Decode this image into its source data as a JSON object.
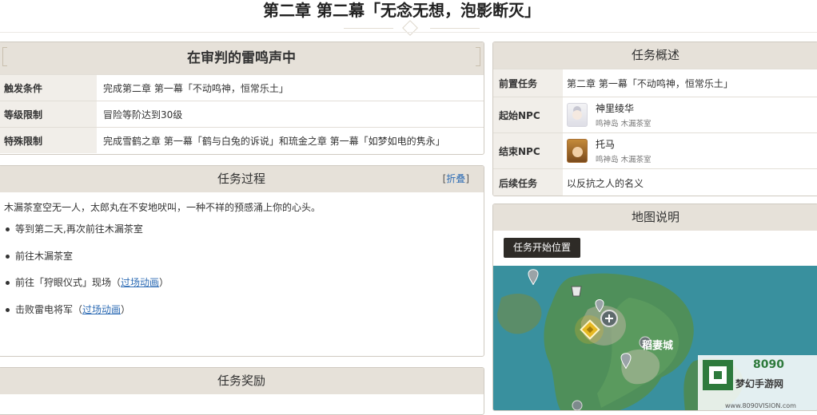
{
  "page": {
    "title": "第二章 第二幕「无念无想，泡影断灭」"
  },
  "trigger": {
    "heading": "在审判的雷鸣声中",
    "rows": [
      {
        "key": "触发条件",
        "value": "完成第二章 第一幕「不动鸣神，恒常乐土」"
      },
      {
        "key": "等级限制",
        "value": "冒险等阶达到30级"
      },
      {
        "key": "特殊限制",
        "value": "完成雪鹤之章 第一幕「鹤与白兔的诉说」和琉金之章 第一幕「如梦如电的隽永」"
      }
    ]
  },
  "process": {
    "heading": "任务过程",
    "collapse_open": "[",
    "collapse_label": "折叠",
    "collapse_close": "]",
    "intro": "木漏茶室空无一人，太郎丸在不安地吠叫，一种不祥的预感涌上你的心头。",
    "steps": [
      {
        "text": "等到第二天,再次前往木漏茶室",
        "link": "",
        "suffix_open": "",
        "suffix_close": ""
      },
      {
        "text": "前往木漏茶室",
        "link": "",
        "suffix_open": "",
        "suffix_close": ""
      },
      {
        "text": "前往「狩眼仪式」现场",
        "link": "过场动画",
        "suffix_open": "（",
        "suffix_close": "）"
      },
      {
        "text": "击败雷电将军",
        "link": "过场动画",
        "suffix_open": "（",
        "suffix_close": "）"
      }
    ]
  },
  "reward": {
    "heading": "任务奖励"
  },
  "overview": {
    "heading": "任务概述",
    "prev_key": "前置任务",
    "prev_value": "第二章 第一幕「不动鸣神，恒常乐土」",
    "start_key": "起始NPC",
    "start_npc": {
      "name": "神里绫华",
      "location": "鸣神岛  木漏茶室"
    },
    "end_key": "结束NPC",
    "end_npc": {
      "name": "托马",
      "location": "鸣神岛  木漏茶室"
    },
    "next_key": "后续任务",
    "next_value": "以反抗之人的名义"
  },
  "map": {
    "heading": "地图说明",
    "tab_label": "任务开始位置",
    "city_label": "稻妻城"
  },
  "watermark": {
    "logo_text": "8090",
    "site_name": "梦幻手游网",
    "url": "www.8090VISION.com"
  },
  "colors": {
    "panel_header": "#e6e1d9",
    "row_key_bg": "#f1eee9",
    "link": "#2f6db5",
    "map_sea": "#3f9aa8",
    "map_land": "#4f8f5a",
    "quest_marker": "#e7b923"
  }
}
